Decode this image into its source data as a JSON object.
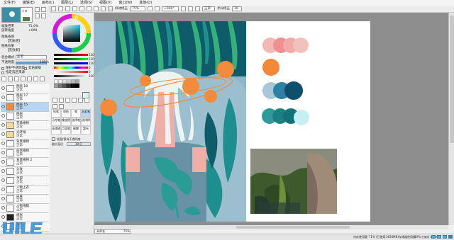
{
  "menu": [
    "文件(F)",
    "编辑(E)",
    "画布(C)",
    "图层(L)",
    "选择(S)",
    "视图(V)",
    "窗口(W)",
    "其他(O)"
  ],
  "toolbar": {
    "stabilizer_label": "抖动修正",
    "zoom_value": "75%",
    "angle_value": "+000°",
    "mode_value": "正常",
    "hand_label": "手抖修正",
    "hand_value": "10"
  },
  "left": {
    "nav_zoom_label": "缩放倍率",
    "nav_zoom_value": "75.0%",
    "nav_angle_label": "旋转角度",
    "nav_angle_value": "+000.",
    "tex_label": "图纸质感",
    "tex_value": "【无质感】",
    "fx_label": "图纸效果",
    "fx_value": "【无效果】",
    "blend_label": "混合模式",
    "blend_value": "正常",
    "opacity_label": "不透明度",
    "opacity_value": "100%",
    "protect_label": "保护不透明度",
    "clip_label": "剪贴蒙版",
    "select_source_label": "指定选区来源",
    "layers": [
      {
        "name": "图层 18",
        "mode": "正常"
      },
      {
        "name": "图层 17",
        "mode": "正常"
      },
      {
        "name": "图层 15",
        "mode": "正常"
      },
      {
        "name": "图层",
        "mode": "正常"
      },
      {
        "name": "花草植物",
        "mode": "正常"
      },
      {
        "name": "光环线",
        "mode": "正常"
      },
      {
        "name": "背景植物",
        "mode": "正常"
      },
      {
        "name": "前景植物",
        "mode": "正常"
      },
      {
        "name": "背景植物 2",
        "mode": "正常"
      },
      {
        "name": "头发",
        "mode": "正常"
      },
      {
        "name": "手部",
        "mode": "正常"
      },
      {
        "name": "人物上衣",
        "mode": "正常"
      },
      {
        "name": "皮肤",
        "mode": "正常"
      },
      {
        "name": "人物线稿",
        "mode": "正常"
      },
      {
        "name": "纸张",
        "mode": "正常"
      },
      {
        "name": "背景",
        "mode": "正常"
      }
    ]
  },
  "color": {
    "sliders": [
      {
        "name": "R",
        "value": "230"
      },
      {
        "name": "G",
        "value": "230"
      },
      {
        "name": "B",
        "value": "230"
      },
      {
        "name": "H",
        "value": "0"
      },
      {
        "name": "S",
        "value": "0"
      },
      {
        "name": "V",
        "value": "230"
      }
    ],
    "brush_size_label": "最大直径",
    "brush_size_value": "30.0",
    "brush_min_label": "最小直径",
    "brush_min_value": "0%",
    "brush_density_label": "浓度",
    "brush_density_value": "100",
    "tools": [
      "铅笔",
      "喷枪",
      "笔",
      "水彩笔",
      "马克笔",
      "橡皮擦",
      "选择笔",
      "选择擦",
      "油漆桶",
      "二值笔",
      "模糊",
      "散布"
    ],
    "opt_label": "绘图/保持不透明度",
    "opt_value": "无质感"
  },
  "palette": {
    "swatches": [
      "#f2b8b6",
      "#ef8f93",
      "#f4a9a8",
      "#f2c0bd",
      "#f28838",
      "#a9c7d8",
      "#2d7fa3",
      "#0e4f6e",
      "#2e9b9b",
      "#1b7f84",
      "#12727a",
      "#c7eef2"
    ]
  },
  "colors": {
    "bg_blue": "#8fb7cc",
    "canvas_white": "#ffffff",
    "plant_dark": "#0e5b6a",
    "plant_mid": "#1f8e8e",
    "plant_green": "#35b07a",
    "skin": "#efafa7",
    "hair": "#eef3f4",
    "shirt": "#6a92a6",
    "orange": "#f28b3b",
    "accent_status": "#5fa8c8"
  },
  "status": {
    "doc_name": "未命名",
    "doc_zoom": "75%",
    "mem_label": "内存使用量",
    "mem_value": "71%",
    "res_label": "(已使用",
    "res_value": "3628MB)",
    "disk_label": "存储器使用量",
    "disk_value": "10%",
    "disk_extra": "(已使用 1174MB)"
  }
}
